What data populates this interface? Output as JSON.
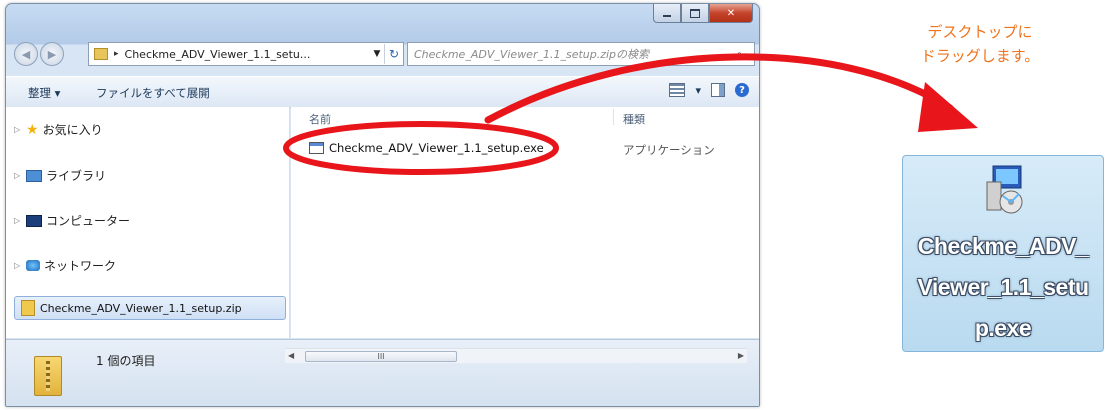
{
  "window": {
    "address": "Checkme_ADV_Viewer_1.1_setu...",
    "search_placeholder": "Checkme_ADV_Viewer_1.1_setup.zipの検索",
    "toolbar": {
      "organize": "整理 ▾",
      "extract_all": "ファイルをすべて展開"
    },
    "nav": {
      "favorites": "お気に入り",
      "libraries": "ライブラリ",
      "computer": "コンピューター",
      "network": "ネットワーク",
      "selected_zip": "Checkme_ADV_Viewer_1.1_setup.zip"
    },
    "columns": {
      "name": "名前",
      "type": "種類"
    },
    "file": {
      "name": "Checkme_ADV_Viewer_1.1_setup.exe",
      "type": "アプリケーション"
    },
    "details": {
      "count": "1 個の項目"
    },
    "scroll_thumb": "III"
  },
  "instruction": {
    "line1": "デスクトップに",
    "line2": "ドラッグします。"
  },
  "desktop_icon": {
    "label_lines": [
      "Checkme_ADV_",
      "Viewer_1.1_setu",
      "p.exe"
    ]
  },
  "colors": {
    "annotation_red": "#e8161a",
    "instruction_orange": "#f0731b"
  },
  "icons": [
    "back-icon",
    "forward-icon",
    "folder-icon",
    "refresh-icon",
    "search-icon",
    "star-icon",
    "library-icon",
    "computer-icon",
    "network-icon",
    "zip-icon",
    "exe-icon",
    "installer-icon",
    "help-icon"
  ]
}
